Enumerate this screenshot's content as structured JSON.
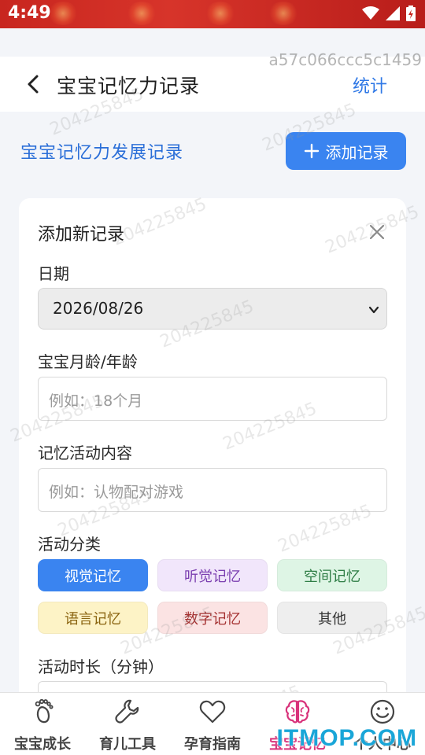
{
  "status_bar": {
    "time": "4:49"
  },
  "header": {
    "title": "宝宝记忆力记录",
    "stats_link": "统计"
  },
  "section": {
    "title": "宝宝记忆力发展记录",
    "add_button": "添加记录"
  },
  "form": {
    "title": "添加新记录",
    "date_label": "日期",
    "date_value": "2026/08/26",
    "age_label": "宝宝月龄/年龄",
    "age_placeholder": "例如：18个月",
    "activity_label": "记忆活动内容",
    "activity_placeholder": "例如：认物配对游戏",
    "category_label": "活动分类",
    "categories": [
      {
        "label": "视觉记忆",
        "selected": true,
        "bg": "#3a84f0",
        "fg": "#ffffff"
      },
      {
        "label": "听觉记忆",
        "selected": false,
        "bg": "#f1e6fb",
        "fg": "#7b3fb0"
      },
      {
        "label": "空间记忆",
        "selected": false,
        "bg": "#def5e5",
        "fg": "#2e7d45"
      },
      {
        "label": "语言记忆",
        "selected": false,
        "bg": "#fdf3c6",
        "fg": "#8a6410"
      },
      {
        "label": "数字记忆",
        "selected": false,
        "bg": "#fbe3e3",
        "fg": "#a43030"
      },
      {
        "label": "其他",
        "selected": false,
        "bg": "#eeeeee",
        "fg": "#333333"
      }
    ],
    "duration_label": "活动时长（分钟）"
  },
  "bottom_nav": {
    "items": [
      {
        "label": "宝宝成长",
        "icon": "baby-foot-icon"
      },
      {
        "label": "育儿工具",
        "icon": "wrench-icon"
      },
      {
        "label": "孕育指南",
        "icon": "heart-icon"
      },
      {
        "label": "宝宝记忆",
        "icon": "brain-icon",
        "active": true
      },
      {
        "label": "个人中心",
        "icon": "smiley-icon"
      }
    ]
  },
  "watermarks": {
    "hash": "a57c066ccc5c1459",
    "number": "204225845",
    "site": "ITMOP.COM"
  },
  "colors": {
    "accent": "#3a84f0",
    "link": "#2f78e6",
    "nav_active": "#d8327a",
    "status_bar": "#c8261f"
  }
}
